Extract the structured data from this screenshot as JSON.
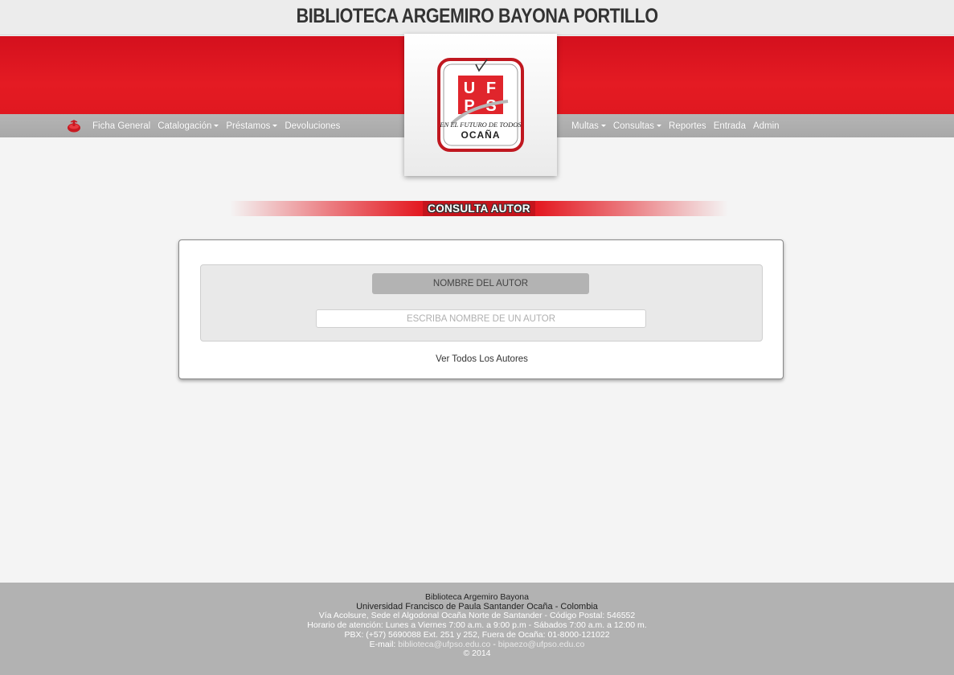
{
  "header": {
    "title": "BIBLIOTECA ARGEMIRO BAYONA PORTILLO"
  },
  "nav": {
    "left": [
      {
        "label": "Ficha General",
        "dropdown": false
      },
      {
        "label": "Catalogación",
        "dropdown": true
      },
      {
        "label": "Préstamos",
        "dropdown": true
      },
      {
        "label": "Devoluciones",
        "dropdown": false
      }
    ],
    "right": [
      {
        "label": "Multas",
        "dropdown": true
      },
      {
        "label": "Consultas",
        "dropdown": true
      },
      {
        "label": "Reportes",
        "dropdown": false
      },
      {
        "label": "Entrada",
        "dropdown": false
      },
      {
        "label": "Admin",
        "dropdown": false
      }
    ],
    "home_icon": "library-logo-icon"
  },
  "logo": {
    "text_top": "EN EL FUTURO DE TODOS",
    "text_city": "OCAÑA",
    "letters": "UFPS"
  },
  "main": {
    "section_title": "CONSULTA AUTOR",
    "field_label": "NOMBRE DEL AUTOR",
    "search_placeholder": "ESCRIBA NOMBRE DE UN AUTOR",
    "search_value": "",
    "view_all_link": "Ver Todos Los Autores"
  },
  "footer": {
    "name": "Biblioteca Argemiro Bayona",
    "university": "Universidad Francisco de Paula Santander Ocaña - Colombia",
    "address": "Vía Acolsure, Sede el Algodonal Ocaña Norte de Santander - Código Postal: 546552",
    "hours": "Horario de atención: Lunes a Viernes 7:00 a.m. a 9:00 p.m - Sábados 7:00 a.m. a 12:00 m.",
    "phone": "PBX: (+57) 5690088 Ext. 251 y 252, Fuera de Ocaña: 01-8000-121022",
    "email_prefix": "E-mail: ",
    "email_1": "biblioteca@ufpso.edu.co",
    "email_sep": " - ",
    "email_2": "bipaezo@ufpso.edu.co",
    "copyright": "© 2014"
  },
  "colors": {
    "brand_red": "#e41b23",
    "nav_gray": "#aeaeae",
    "footer_gray": "#b2b2b2"
  }
}
